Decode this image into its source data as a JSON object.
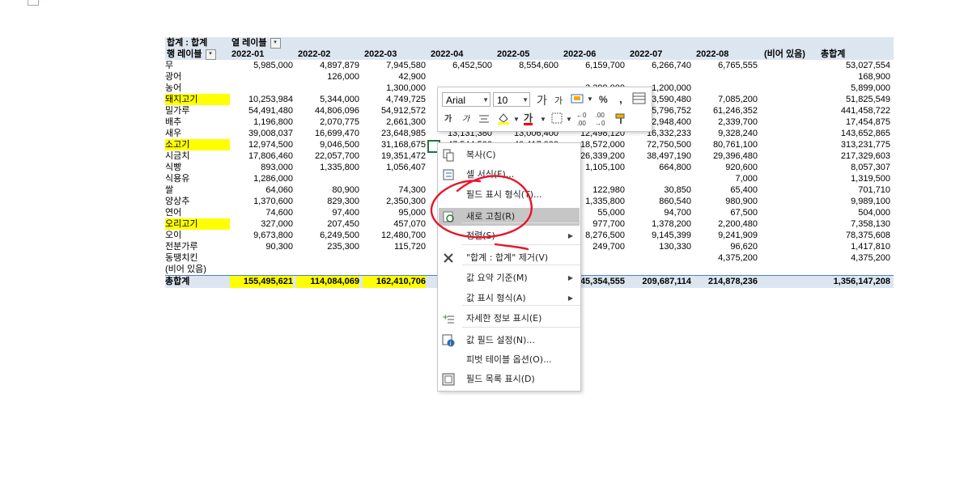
{
  "pivot": {
    "header_row1": {
      "label": "합계 : 합계",
      "col_labels": "열 레이블"
    },
    "header_row2": {
      "row_labels": "행 레이블",
      "columns": [
        "2022-01",
        "2022-02",
        "2022-03",
        "2022-04",
        "2022-05",
        "2022-06",
        "2022-07",
        "2022-08",
        "(비어 있음)",
        "총합계"
      ]
    },
    "rows": [
      {
        "label": "무",
        "values": [
          "5,985,000",
          "4,897,879",
          "7,945,580",
          "6,452,500",
          "8,554,600",
          "6,159,700",
          "6,266,740",
          "6,765,555",
          "",
          "53,027,554"
        ]
      },
      {
        "label": "광어",
        "values": [
          "",
          "126,000",
          "42,900",
          "",
          "",
          "",
          "",
          "",
          "",
          "168,900"
        ]
      },
      {
        "label": "농어",
        "values": [
          "",
          "",
          "1,300,000",
          "",
          "",
          "3,399,000",
          "1,200,000",
          "",
          "",
          "5,899,000"
        ]
      },
      {
        "label": "돼지고기",
        "highlight": true,
        "values": [
          "10,253,984",
          "5,344,000",
          "4,749,725",
          "",
          "",
          "",
          "3,590,480",
          "7,085,200",
          "",
          "51,825,549"
        ]
      },
      {
        "label": "밀가루",
        "values": [
          "54,491,480",
          "44,806,096",
          "54,912,572",
          "",
          "",
          "",
          "5,796,752",
          "61,246,352",
          "",
          "441,458,722"
        ]
      },
      {
        "label": "배추",
        "values": [
          "1,196,800",
          "2,070,775",
          "2,661,300",
          "",
          "",
          "",
          "2,948,400",
          "2,339,700",
          "",
          "17,454,875"
        ]
      },
      {
        "label": "새우",
        "values": [
          "39,008,037",
          "16,699,470",
          "23,648,985",
          "13,131,380",
          "13,006,400",
          "12,498,120",
          "16,332,233",
          "9,328,240",
          "",
          "143,652,865"
        ]
      },
      {
        "label": "소고기",
        "highlight": true,
        "values": [
          "12,974,500",
          "9,046,500",
          "31,168,675",
          "47,544,500",
          "40,417,000",
          "18,572,000",
          "72,750,500",
          "80,761,100",
          "",
          "313,231,775"
        ]
      },
      {
        "label": "시금치",
        "values": [
          "17,806,460",
          "22,057,700",
          "19,351,472",
          "",
          "",
          "26,339,200",
          "38,497,190",
          "29,396,480",
          "",
          "217,329,603"
        ]
      },
      {
        "label": "식빵",
        "values": [
          "893,000",
          "1,335,800",
          "1,056,407",
          "",
          "",
          "1,105,100",
          "664,800",
          "920,600",
          "",
          "8,057,307"
        ]
      },
      {
        "label": "식용유",
        "values": [
          "1,286,000",
          "",
          "",
          "",
          "",
          "",
          "",
          "7,000",
          "",
          "1,319,500"
        ]
      },
      {
        "label": "쌀",
        "values": [
          "64,060",
          "80,900",
          "74,300",
          "",
          "",
          "122,980",
          "30,850",
          "65,400",
          "",
          "701,710"
        ]
      },
      {
        "label": "양상추",
        "values": [
          "1,370,600",
          "829,300",
          "2,350,300",
          "",
          "",
          "1,335,800",
          "860,540",
          "980,900",
          "",
          "9,989,100"
        ]
      },
      {
        "label": "연어",
        "values": [
          "74,600",
          "97,400",
          "95,000",
          "",
          "",
          "55,000",
          "94,700",
          "67,500",
          "",
          "504,000"
        ]
      },
      {
        "label": "오리고기",
        "highlight": true,
        "values": [
          "327,000",
          "207,450",
          "457,070",
          "",
          "",
          "977,700",
          "1,378,200",
          "2,200,480",
          "",
          "7,358,130"
        ]
      },
      {
        "label": "오이",
        "values": [
          "9,673,800",
          "6,249,500",
          "12,480,700",
          "",
          "",
          "8,276,500",
          "9,145,399",
          "9,241,909",
          "",
          "78,375,608"
        ]
      },
      {
        "label": "전분가루",
        "values": [
          "90,300",
          "235,300",
          "115,720",
          "",
          "",
          "249,700",
          "130,330",
          "96,620",
          "",
          "1,417,810"
        ]
      },
      {
        "label": "동땡치킨",
        "values": [
          "",
          "",
          "",
          "",
          "",
          "",
          "",
          "4,375,200",
          "",
          "4,375,200"
        ]
      },
      {
        "label": "(비어 있음)",
        "values": [
          "",
          "",
          "",
          "",
          "",
          "",
          "",
          "",
          "",
          ""
        ]
      }
    ],
    "total": {
      "label": "총합계",
      "values": [
        "155,495,621",
        "114,084,069",
        "162,410,706",
        "",
        "",
        "45,354,555",
        "209,687,114",
        "214,878,236",
        "",
        "1,356,147,208"
      ]
    }
  },
  "mini_toolbar": {
    "font": "Arial",
    "size": "10",
    "increase_font": "가",
    "decrease_font": "가",
    "percent": "%",
    "comma": ",",
    "bold": "가",
    "italic": "가",
    "font_color_glyph": "가",
    "inc_decimal": ".00",
    "dec_decimal": ".00"
  },
  "context_menu": {
    "items": [
      {
        "label": "복사(C)",
        "icon": "copy-icon"
      },
      {
        "label": "셀 서식(F)...",
        "icon": "format-cells-icon"
      },
      {
        "label": "필드 표시 형식(T)...",
        "icon": ""
      },
      {
        "label": "새로 고침(R)",
        "icon": "refresh-icon",
        "highlighted": true
      },
      {
        "label": "정렬(S)",
        "icon": "",
        "submenu": true
      },
      {
        "label": "\"합계 : 합계\" 제거(V)",
        "icon": "remove-icon"
      },
      {
        "label": "값 요약 기준(M)",
        "icon": "",
        "submenu": true
      },
      {
        "label": "값 표시 형식(A)",
        "icon": "",
        "submenu": true
      },
      {
        "label": "자세한 정보 표시(E)",
        "icon": "show-details-icon"
      },
      {
        "label": "값 필드 설정(N)...",
        "icon": "value-field-settings-icon"
      },
      {
        "label": "피벗 테이블 옵션(O)...",
        "icon": ""
      },
      {
        "label": "필드 목록 표시(D)",
        "icon": "field-list-icon"
      }
    ]
  },
  "colors": {
    "header_bg": "#dce6f1",
    "highlight": "#ffff00",
    "menu_hover": "#c6c6c6",
    "annotation": "#e8142a"
  }
}
